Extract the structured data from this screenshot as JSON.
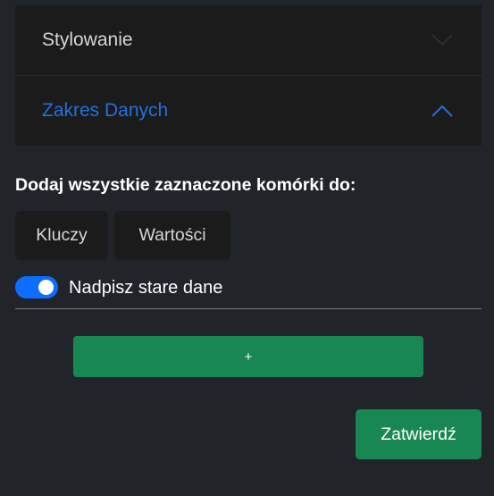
{
  "accordion": {
    "items": [
      {
        "label": "Stylowanie",
        "expanded": false
      },
      {
        "label": "Zakres Danych",
        "expanded": true
      }
    ]
  },
  "range": {
    "title": "Dodaj wszystkie zaznaczone komórki do:",
    "keys_label": "Kluczy",
    "values_label": "Wartości",
    "overwrite_label": "Nadpisz stare dane",
    "overwrite_on": true,
    "add_label": "+",
    "submit_label": "Zatwierdź"
  },
  "colors": {
    "accent": "#2470e0",
    "toggle": "#0d6efd",
    "success": "#198754"
  }
}
